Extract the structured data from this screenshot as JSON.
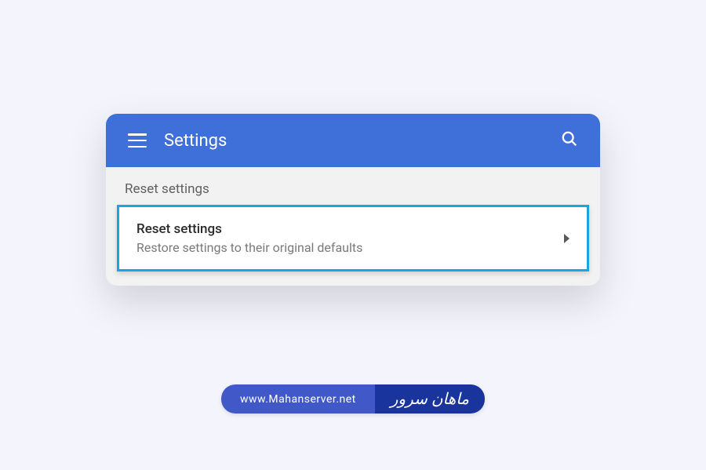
{
  "header": {
    "title": "Settings"
  },
  "section": {
    "heading": "Reset settings"
  },
  "reset_card": {
    "title": "Reset settings",
    "description": "Restore settings to their original defaults"
  },
  "footer": {
    "url": "www.Mahanserver.net",
    "logo_text": "ماهان سرور"
  }
}
